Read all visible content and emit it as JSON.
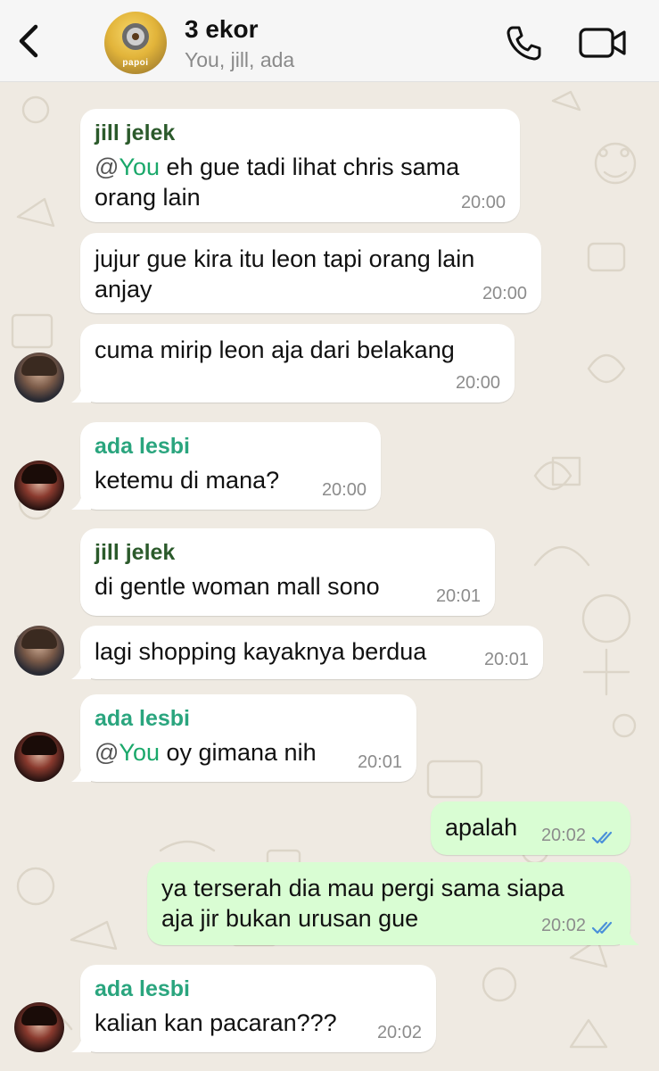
{
  "header": {
    "title": "3 ekor",
    "subtitle": "You, jill, ada",
    "avatar_caption": "papoi",
    "back_icon": "chevron-left-icon",
    "call_icon": "phone-icon",
    "video_icon": "video-camera-icon"
  },
  "messages": [
    {
      "sender": "jill jelek",
      "mention": "You",
      "text": " eh gue tadi lihat chris sama\norang lain",
      "time": "20:00"
    },
    {
      "text": "jujur gue kira itu leon tapi orang lain\nanjay",
      "time": "20:00"
    },
    {
      "text": "cuma mirip leon aja dari belakang",
      "time": "20:00"
    },
    {
      "sender": "ada lesbi",
      "text": "ketemu di mana?",
      "time": "20:00"
    },
    {
      "sender": "jill jelek",
      "text": "di gentle woman mall sono",
      "time": "20:01"
    },
    {
      "text": "lagi shopping kayaknya berdua",
      "time": "20:01"
    },
    {
      "sender": "ada lesbi",
      "mention": "You",
      "text": " oy gimana nih",
      "time": "20:01"
    },
    {
      "text": "apalah",
      "time": "20:02",
      "outgoing": true
    },
    {
      "text": "ya terserah dia mau pergi sama siapa\naja jir bukan urusan gue",
      "time": "20:02",
      "outgoing": true
    },
    {
      "sender": "ada lesbi",
      "text": "kalian kan pacaran???",
      "time": "20:02"
    }
  ],
  "colors": {
    "outgoing_bubble": "#d9fdd3",
    "incoming_bubble": "#ffffff",
    "jill_name": "#2b5a2b",
    "ada_name": "#2aa57e",
    "read_ticks": "#4a90d9"
  }
}
